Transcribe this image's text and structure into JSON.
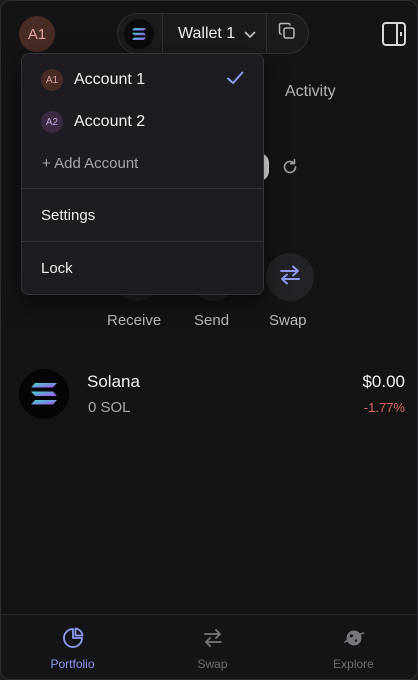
{
  "header": {
    "avatar_initials": "A1",
    "wallet_name": "Wallet 1"
  },
  "background": {
    "activity_tab": "Activity",
    "actions": {
      "receive": "Receive",
      "send": "Send",
      "swap": "Swap"
    }
  },
  "tokens": [
    {
      "name": "Solana",
      "amount": "0 SOL",
      "value": "$0.00",
      "change": "-1.77%"
    }
  ],
  "bottom_nav": {
    "items": [
      {
        "label": "Portfolio",
        "icon": "pie-chart-icon",
        "active": true
      },
      {
        "label": "Swap",
        "icon": "swap-arrows-icon",
        "active": false
      },
      {
        "label": "Explore",
        "icon": "planet-icon",
        "active": false
      }
    ]
  },
  "dropdown": {
    "accounts": [
      {
        "initials": "A1",
        "label": "Account 1",
        "selected": true
      },
      {
        "initials": "A2",
        "label": "Account 2",
        "selected": false
      }
    ],
    "add_account": "+ Add Account",
    "settings": "Settings",
    "lock": "Lock"
  },
  "colors": {
    "accent": "#8f9af5",
    "negative": "#e0665a",
    "background": "#141416"
  }
}
